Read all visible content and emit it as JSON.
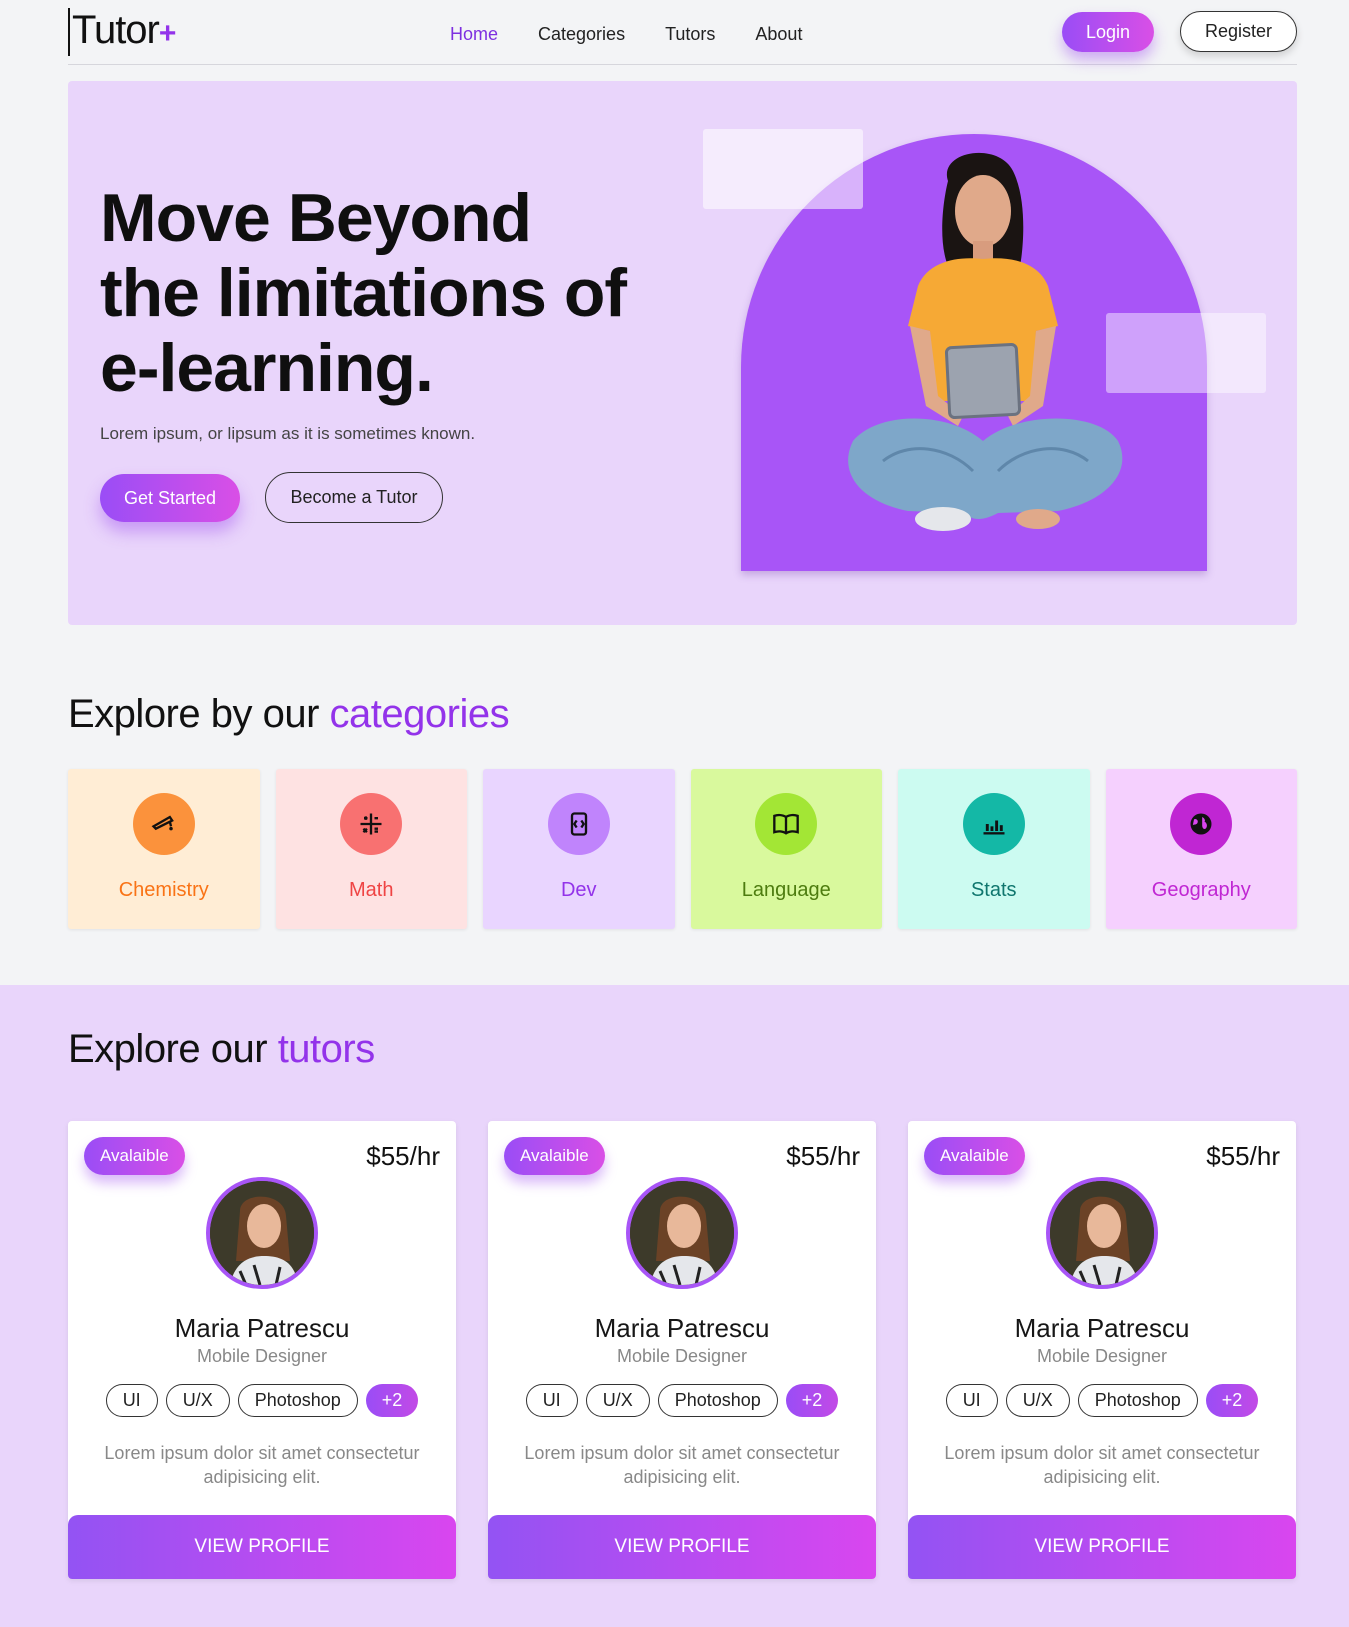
{
  "nav": {
    "logo_text": "Tutor",
    "logo_plus": "+",
    "links": [
      "Home",
      "Categories",
      "Tutors",
      "About"
    ],
    "login_label": "Login",
    "register_label": "Register"
  },
  "hero": {
    "title_line1": "Move Beyond",
    "title_line2": "the limitations of",
    "title_line3": "e-learning.",
    "subtitle": "Lorem ipsum, or lipsum as it is sometimes known.",
    "primary_button": "Get Started",
    "secondary_button": "Become a Tutor"
  },
  "categories": {
    "title_plain": "Explore by our",
    "title_accent": "categories",
    "items": [
      {
        "label": "Chemistry",
        "icon": "flask-icon",
        "bg": "#ffedd5",
        "circle": "#fb923c",
        "text": "#f97316"
      },
      {
        "label": "Math",
        "icon": "calculator-icon",
        "bg": "#fee2e2",
        "circle": "#f87171",
        "text": "#ef4444"
      },
      {
        "label": "Dev",
        "icon": "code-device-icon",
        "bg": "#e9d5ff",
        "circle": "#c084fc",
        "text": "#9333ea"
      },
      {
        "label": "Language",
        "icon": "book-icon",
        "bg": "#d9f99d",
        "circle": "#a3e635",
        "text": "#4d7c0f"
      },
      {
        "label": "Stats",
        "icon": "bar-chart-icon",
        "bg": "#ccfbf1",
        "circle": "#14b8a6",
        "text": "#0f766e"
      },
      {
        "label": "Geography",
        "icon": "globe-icon",
        "bg": "#f5d0fe",
        "circle": "#c026d3",
        "text": "#c026d3"
      }
    ]
  },
  "tutors": {
    "title_plain": "Explore our",
    "title_accent": "tutors",
    "cards": [
      {
        "badge": "Avalaible",
        "price": "$55/hr",
        "name": "Maria Patrescu",
        "role": "Mobile Designer",
        "tags": [
          "UI",
          "U/X",
          "Photoshop"
        ],
        "more": "+2",
        "description": "Lorem ipsum dolor sit amet consectetur adipisicing elit.",
        "button": "VIEW PROFILE"
      },
      {
        "badge": "Avalaible",
        "price": "$55/hr",
        "name": "Maria Patrescu",
        "role": "Mobile Designer",
        "tags": [
          "UI",
          "U/X",
          "Photoshop"
        ],
        "more": "+2",
        "description": "Lorem ipsum dolor sit amet consectetur adipisicing elit.",
        "button": "VIEW PROFILE"
      },
      {
        "badge": "Avalaible",
        "price": "$55/hr",
        "name": "Maria Patrescu",
        "role": "Mobile Designer",
        "tags": [
          "UI",
          "U/X",
          "Photoshop"
        ],
        "more": "+2",
        "description": "Lorem ipsum dolor sit amet consectetur adipisicing elit.",
        "button": "VIEW PROFILE"
      }
    ]
  },
  "colors": {
    "accent": "#9333ea",
    "hero_bg": "#e9d5fb",
    "arch": "#a855f7"
  }
}
